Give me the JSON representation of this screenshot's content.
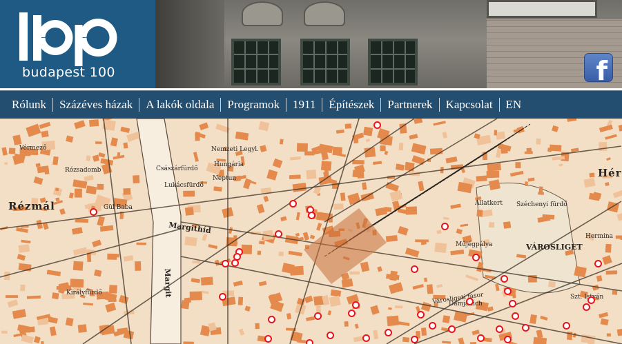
{
  "header": {
    "logo_text": "budapest 100",
    "logo_icon": "budapest-100-logo",
    "facebook_icon": "facebook-icon"
  },
  "nav": {
    "items": [
      "Rólunk",
      "Százéves házak",
      "A lakók oldala",
      "Programok",
      "1911",
      "Építészek",
      "Partnerek",
      "Kapcsolat",
      "EN"
    ]
  },
  "map": {
    "labels": [
      {
        "text": "Rézmál"
      },
      {
        "text": "Margithíd"
      },
      {
        "text": "Margit"
      },
      {
        "text": "Császárfürdő"
      },
      {
        "text": "Lukácsfürdő"
      },
      {
        "text": "Neptun"
      },
      {
        "text": "Hungária"
      },
      {
        "text": "Nemzeti Legyl."
      },
      {
        "text": "Gül Baba"
      },
      {
        "text": "Királyfürdő"
      },
      {
        "text": "Vérmező"
      },
      {
        "text": "Rózsadomb"
      },
      {
        "text": "VÁROSLIGET"
      },
      {
        "text": "Városligeti fasor"
      },
      {
        "text": "Damjanich"
      },
      {
        "text": "Állatkert"
      },
      {
        "text": "Széchenyi fürdő"
      },
      {
        "text": "Műjégpálya"
      },
      {
        "text": "Szt. István"
      },
      {
        "text": "Hermina"
      },
      {
        "text": "Hér"
      }
    ],
    "marker_count": 40
  },
  "colors": {
    "brand_blue": "#1f5a84",
    "nav_bg": "#234e6f",
    "map_paper": "#f2dfc6",
    "map_block": "#e58a4d",
    "marker_red": "#e8141b"
  }
}
